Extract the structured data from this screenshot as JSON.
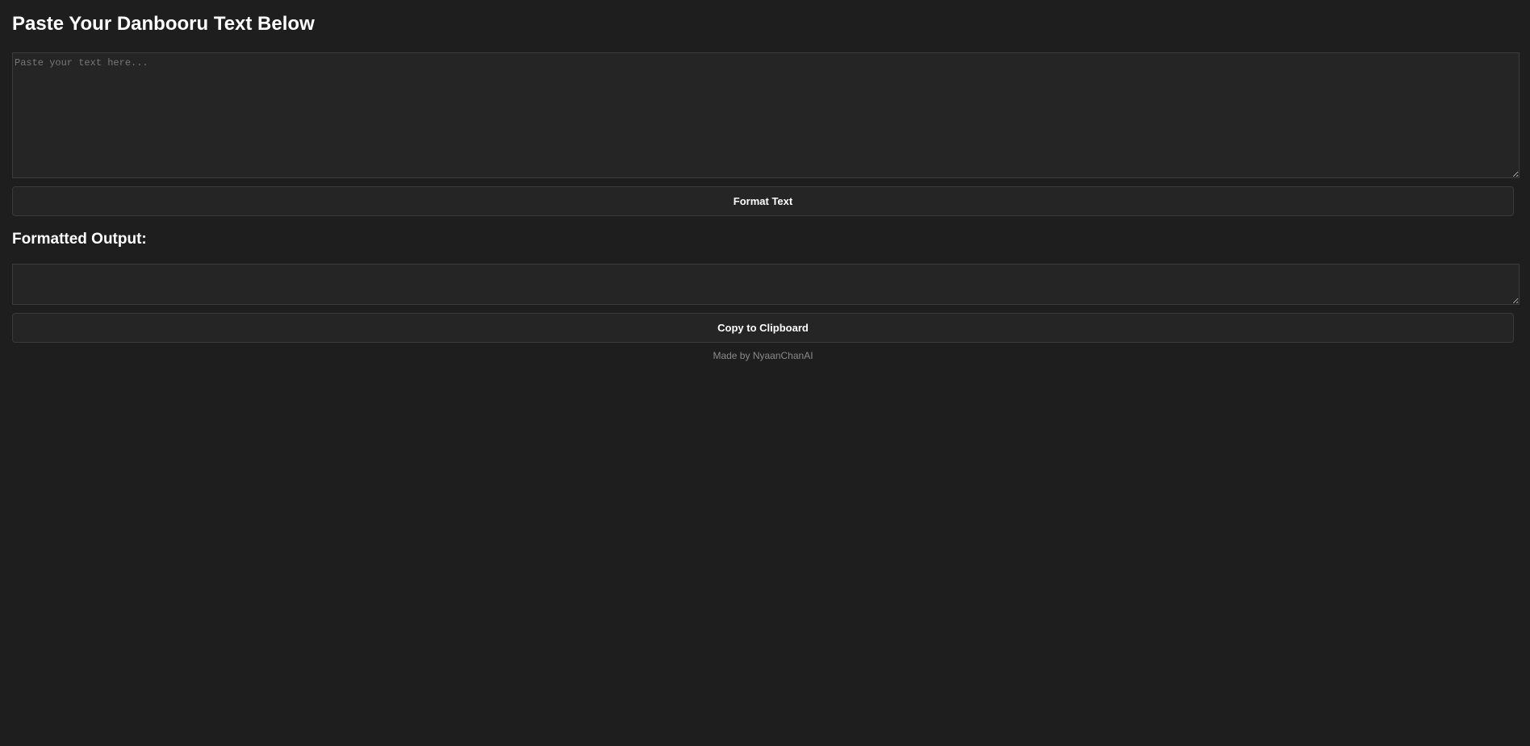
{
  "header": {
    "title": "Paste Your Danbooru Text Below"
  },
  "input": {
    "placeholder": "Paste your text here...",
    "value": ""
  },
  "format_button": {
    "label": "Format Text"
  },
  "output_section": {
    "title": "Formatted Output:",
    "value": ""
  },
  "copy_button": {
    "label": "Copy to Clipboard"
  },
  "footer": {
    "text": "Made by NyaanChanAI"
  }
}
